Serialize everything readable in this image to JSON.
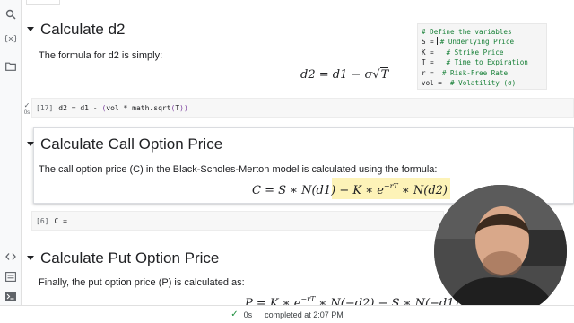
{
  "rail": {
    "icons": [
      "search-icon",
      "variables-icon",
      "folder-icon",
      "code-icon",
      "terminal-list-icon",
      "terminal-icon"
    ],
    "variables_glyph": "{x}"
  },
  "sections": {
    "d2": {
      "heading": "Calculate d2",
      "text": "The formula for d2 is simply:",
      "formula_lhs": "d2 = d1 − σ",
      "formula_sqrt": "T"
    },
    "call": {
      "heading": "Calculate Call Option Price",
      "text": "The call option price (C) in the Black-Scholes-Merton model is calculated using the formula:",
      "f1": "C = S ∗ N(d1) − K ∗ e",
      "f1_sup": "−rT",
      "f1_tail": " ∗ N(d2)"
    },
    "put": {
      "heading": "Calculate Put Option Price",
      "text": "Finally, the put option price (P) is calculated as:",
      "f1": "P = K ∗ e",
      "f1_sup": "−rT",
      "f1_tail": " ∗ N(−d2) − S ∗ N(−d1)"
    }
  },
  "variables_block": {
    "header": "# Define the variables",
    "rows": [
      {
        "name": "S =",
        "comment": "# Underlying Price"
      },
      {
        "name": "K =",
        "comment": "# Strike Price"
      },
      {
        "name": "T =",
        "comment": "# Time to Expiration"
      },
      {
        "name": "r =",
        "comment": "# Risk-Free Rate"
      },
      {
        "name": "vol =",
        "comment": "# Volatility (σ)"
      }
    ]
  },
  "code_cells": [
    {
      "exec": "[17]",
      "code_start": "d2 = d1 - ",
      "code_paren": "(",
      "code_mid": "vol * math.sqrt",
      "code_paren2": "(",
      "code_arg": "T",
      "code_end": "))",
      "run_time": "0s"
    },
    {
      "exec": "[6]",
      "code": "C ="
    }
  ],
  "status": {
    "check": "✓",
    "duration": "0s",
    "message": "completed at 2:07 PM"
  },
  "colors": {
    "highlight": "#fdf3b8",
    "comment_green": "#188038",
    "check_green": "#1e8e3e"
  }
}
